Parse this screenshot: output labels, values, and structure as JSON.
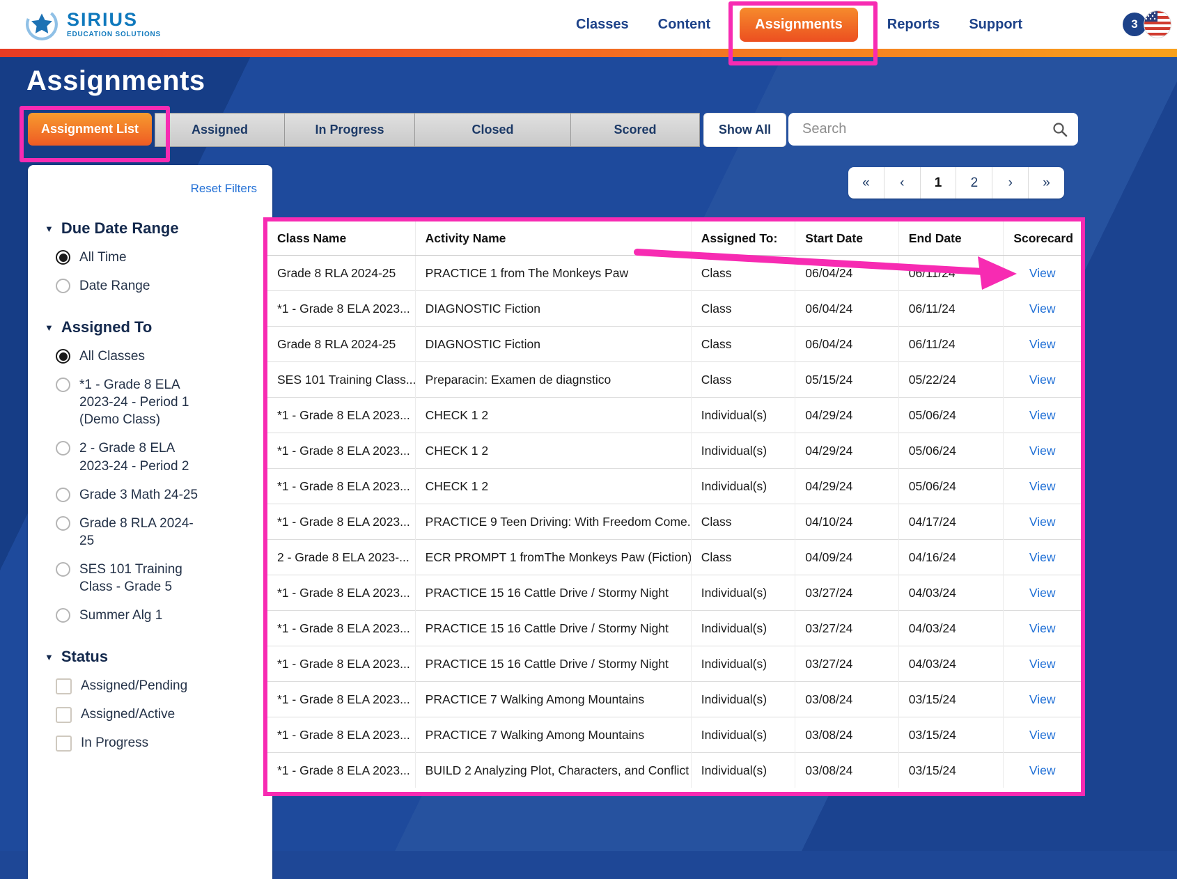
{
  "brand": {
    "name": "SIRIUS",
    "tagline": "EDUCATION SOLUTIONS"
  },
  "nav": {
    "items": [
      "Classes",
      "Content",
      "Assignments",
      "Reports",
      "Support"
    ],
    "active": "Assignments",
    "notification_count": "3"
  },
  "page": {
    "title": "Assignments"
  },
  "tabs": {
    "items": [
      {
        "label": "Assignment List",
        "active": true
      },
      {
        "label": "Assigned",
        "active": false
      },
      {
        "label": "In Progress",
        "active": false
      },
      {
        "label": "Closed",
        "active": false
      },
      {
        "label": "Scored",
        "active": false
      }
    ]
  },
  "actions": {
    "show_all": "Show All"
  },
  "search": {
    "placeholder": "Search"
  },
  "pagination": {
    "items": [
      "«",
      "‹",
      "1",
      "2",
      "›",
      "»"
    ],
    "current": "1"
  },
  "filters": {
    "reset_label": "Reset Filters",
    "collapse_icon": "▼",
    "sections": [
      {
        "title": "Due Date Range",
        "type": "radio",
        "options": [
          {
            "label": "All Time",
            "selected": true
          },
          {
            "label": "Date Range",
            "selected": false
          }
        ]
      },
      {
        "title": "Assigned To",
        "type": "radio",
        "options": [
          {
            "label": "All Classes",
            "selected": true
          },
          {
            "label": "*1 - Grade 8 ELA 2023-24 - Period 1 (Demo Class)",
            "selected": false
          },
          {
            "label": "2 - Grade 8 ELA 2023-24 - Period 2",
            "selected": false
          },
          {
            "label": "Grade 3 Math 24-25",
            "selected": false
          },
          {
            "label": "Grade 8 RLA 2024-25",
            "selected": false
          },
          {
            "label": "SES 101 Training Class - Grade 5",
            "selected": false
          },
          {
            "label": "Summer Alg 1",
            "selected": false
          }
        ]
      },
      {
        "title": "Status",
        "type": "checkbox",
        "options": [
          {
            "label": "Assigned/Pending",
            "selected": false
          },
          {
            "label": "Assigned/Active",
            "selected": false
          },
          {
            "label": "In Progress",
            "selected": false
          }
        ]
      }
    ]
  },
  "table": {
    "columns": [
      "Class Name",
      "Activity Name",
      "Assigned To:",
      "Start Date",
      "End Date",
      "Scorecard"
    ],
    "view_label": "View",
    "rows": [
      [
        "Grade 8 RLA 2024-25",
        "PRACTICE 1  from The Monkeys Paw",
        "Class",
        "06/04/24",
        "06/11/24"
      ],
      [
        "*1 - Grade 8 ELA 2023...",
        "DIAGNOSTIC  Fiction",
        "Class",
        "06/04/24",
        "06/11/24"
      ],
      [
        "Grade 8 RLA 2024-25",
        "DIAGNOSTIC  Fiction",
        "Class",
        "06/04/24",
        "06/11/24"
      ],
      [
        "SES 101 Training Class...",
        "Preparacin: Examen de diagnstico",
        "Class",
        "05/15/24",
        "05/22/24"
      ],
      [
        "*1 - Grade 8 ELA 2023...",
        "CHECK 1  2",
        "Individual(s)",
        "04/29/24",
        "05/06/24"
      ],
      [
        "*1 - Grade 8 ELA 2023...",
        "CHECK 1  2",
        "Individual(s)",
        "04/29/24",
        "05/06/24"
      ],
      [
        "*1 - Grade 8 ELA 2023...",
        "CHECK 1  2",
        "Individual(s)",
        "04/29/24",
        "05/06/24"
      ],
      [
        "*1 - Grade 8 ELA 2023...",
        "PRACTICE 9  Teen Driving: With Freedom Come...",
        "Class",
        "04/10/24",
        "04/17/24"
      ],
      [
        "2 - Grade 8 ELA 2023-...",
        "ECR PROMPT 1  fromThe Monkeys Paw (Fiction)",
        "Class",
        "04/09/24",
        "04/16/24"
      ],
      [
        "*1 - Grade 8 ELA 2023...",
        "PRACTICE 15  16  Cattle Drive / Stormy Night",
        "Individual(s)",
        "03/27/24",
        "04/03/24"
      ],
      [
        "*1 - Grade 8 ELA 2023...",
        "PRACTICE 15  16  Cattle Drive / Stormy Night",
        "Individual(s)",
        "03/27/24",
        "04/03/24"
      ],
      [
        "*1 - Grade 8 ELA 2023...",
        "PRACTICE 15  16  Cattle Drive / Stormy Night",
        "Individual(s)",
        "03/27/24",
        "04/03/24"
      ],
      [
        "*1 - Grade 8 ELA 2023...",
        "PRACTICE 7  Walking Among Mountains",
        "Individual(s)",
        "03/08/24",
        "03/15/24"
      ],
      [
        "*1 - Grade 8 ELA 2023...",
        "PRACTICE 7  Walking Among Mountains",
        "Individual(s)",
        "03/08/24",
        "03/15/24"
      ],
      [
        "*1 - Grade 8 ELA 2023...",
        "BUILD 2  Analyzing Plot, Characters, and Conflict",
        "Individual(s)",
        "03/08/24",
        "03/15/24"
      ]
    ]
  },
  "colors": {
    "accent_orange": "#f05a24",
    "navy": "#1d4289",
    "page_background": "#1e4796",
    "annotation_magenta": "#f72bb2",
    "link_blue": "#1f6fd6"
  }
}
